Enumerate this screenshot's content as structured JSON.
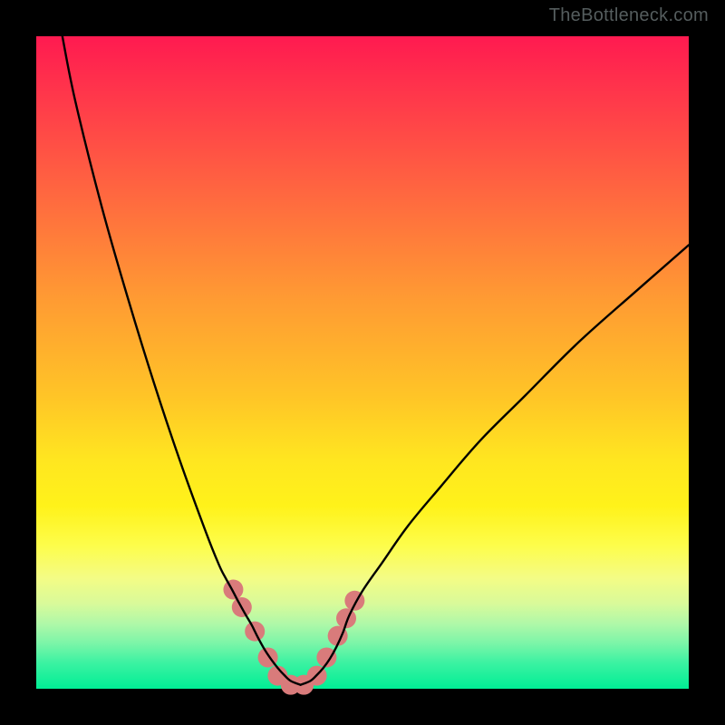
{
  "watermark": "TheBottleneck.com",
  "chart_data": {
    "type": "line",
    "title": "",
    "xlabel": "",
    "ylabel": "",
    "xlim": [
      0,
      100
    ],
    "ylim": [
      0,
      100
    ],
    "grid": false,
    "legend": false,
    "series": [
      {
        "name": "left-branch",
        "x": [
          4,
          6,
          10,
          14,
          18,
          22,
          26,
          28,
          29,
          30,
          31,
          32,
          33,
          33.5,
          34,
          35,
          36,
          37,
          38,
          39,
          40.5
        ],
        "y": [
          100,
          90,
          74,
          60,
          47,
          35,
          24,
          19,
          17,
          15.2,
          13.3,
          11.5,
          9.8,
          8.8,
          7.8,
          6.0,
          4.5,
          3.2,
          2.1,
          1.2,
          0.6
        ]
      },
      {
        "name": "right-branch",
        "x": [
          40.5,
          42,
          43,
          44,
          45,
          46,
          47,
          48,
          50,
          53,
          57,
          62,
          68,
          75,
          83,
          92,
          100
        ],
        "y": [
          0.6,
          1.2,
          2.1,
          3.2,
          4.6,
          6.4,
          8.6,
          11.3,
          15,
          19.3,
          25,
          31,
          38,
          45,
          53,
          61,
          68
        ]
      }
    ],
    "markers": {
      "name": "highlight-points",
      "color": "#d97b7b",
      "radius": 11,
      "points": [
        {
          "x": 30.2,
          "y": 15.2
        },
        {
          "x": 31.5,
          "y": 12.5
        },
        {
          "x": 33.5,
          "y": 8.8
        },
        {
          "x": 35.5,
          "y": 4.8
        },
        {
          "x": 37.0,
          "y": 2.0
        },
        {
          "x": 39.0,
          "y": 0.6
        },
        {
          "x": 41.0,
          "y": 0.6
        },
        {
          "x": 43.0,
          "y": 2.0
        },
        {
          "x": 44.5,
          "y": 4.8
        },
        {
          "x": 46.2,
          "y": 8.1
        },
        {
          "x": 47.5,
          "y": 10.8
        },
        {
          "x": 48.8,
          "y": 13.5
        }
      ]
    },
    "gradient_stops": [
      {
        "pos": 0.0,
        "color": "#ff1a50"
      },
      {
        "pos": 0.72,
        "color": "#fff21a"
      },
      {
        "pos": 1.0,
        "color": "#00ee95"
      }
    ]
  }
}
